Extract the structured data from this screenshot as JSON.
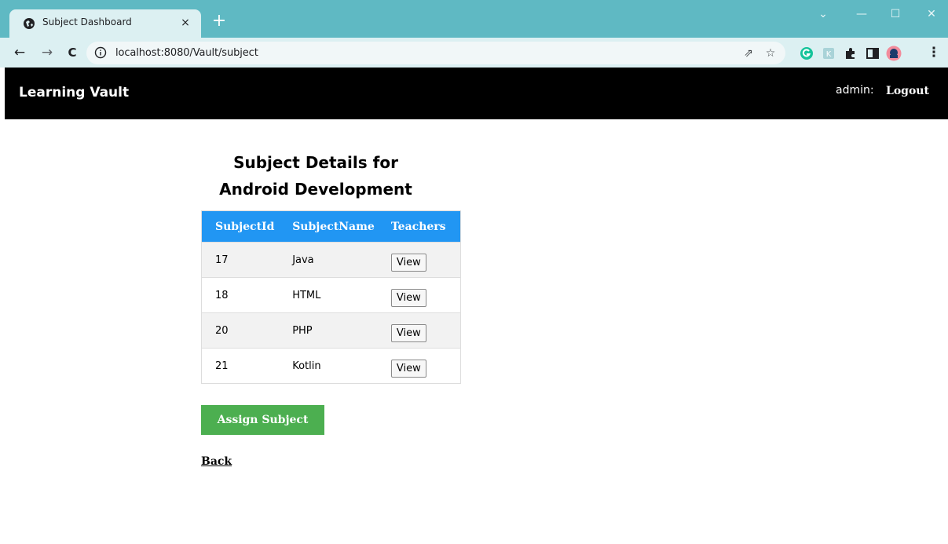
{
  "browser": {
    "tab_title": "Subject Dashboard",
    "tab_close": "×",
    "new_tab": "+",
    "url": "localhost:8080/Vault/subject",
    "window_controls": {
      "menu": "⌄",
      "minimize": "—",
      "maximize": "☐",
      "close": "✕"
    },
    "nav": {
      "back": "←",
      "forward": "→",
      "reload": "C"
    },
    "omnibox_icons": {
      "share": "⇗",
      "bookmark": "☆"
    },
    "extensions": {
      "menu": "⋮"
    }
  },
  "header": {
    "brand": "Learning Vault",
    "user_label": "admin:",
    "logout_label": "Logout"
  },
  "main": {
    "title_line1": "Subject Details for",
    "title_line2": "Android Development",
    "table": {
      "headers": [
        "SubjectId",
        "SubjectName",
        "Teachers"
      ],
      "rows": [
        {
          "id": "17",
          "name": "Java",
          "action": "View"
        },
        {
          "id": "18",
          "name": "HTML",
          "action": "View"
        },
        {
          "id": "20",
          "name": "PHP",
          "action": "View"
        },
        {
          "id": "21",
          "name": "Kotlin",
          "action": "View"
        }
      ]
    },
    "assign_label": "Assign Subject",
    "back_label": "Back"
  },
  "colors": {
    "chrome": "#5fb9c3",
    "toolbar": "#dcf0f2",
    "appbar": "#000000",
    "table_header": "#2196f3",
    "assign_button": "#4caf50"
  }
}
